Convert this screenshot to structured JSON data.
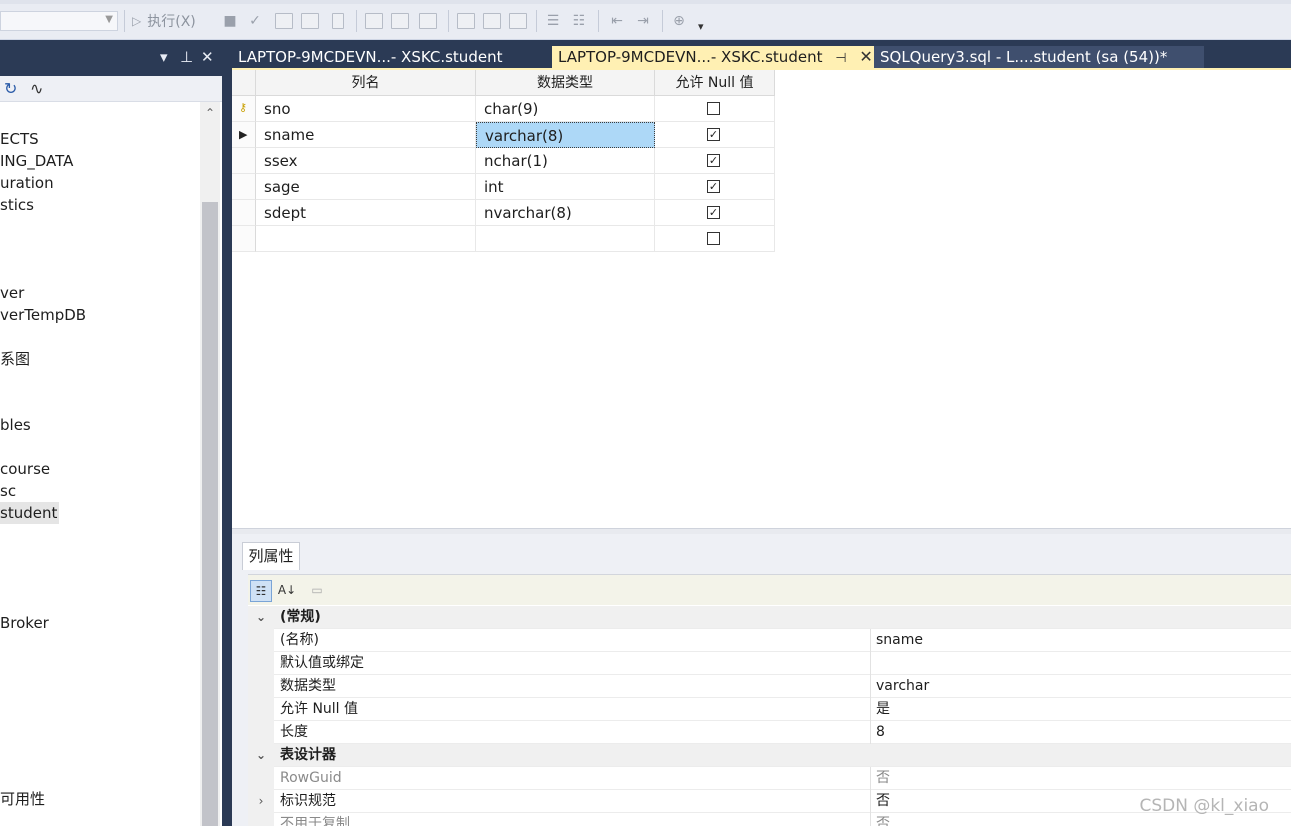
{
  "toolbar": {
    "execute_label": "执行(X)"
  },
  "explorer": {
    "tree_items": [
      "ECTS",
      "ING_DATA",
      "uration",
      "stics",
      "ver",
      "verTempDB",
      "系图",
      "",
      "bles",
      "",
      "course",
      "sc",
      "student",
      "Broker",
      "可用性"
    ]
  },
  "tabs": [
    {
      "label": "LAPTOP-9MCDEVN...- XSKC.student",
      "active": false
    },
    {
      "label": "LAPTOP-9MCDEVN...- XSKC.student",
      "active": true
    },
    {
      "label": "SQLQuery3.sql - L....student (sa (54))*",
      "active": false
    }
  ],
  "grid": {
    "headers": [
      "列名",
      "数据类型",
      "允许 Null 值"
    ],
    "rows": [
      {
        "name": "sno",
        "type": "char(9)",
        "nullable": false,
        "is_key": true,
        "current": false
      },
      {
        "name": "sname",
        "type": "varchar(8)",
        "nullable": true,
        "is_key": false,
        "current": true
      },
      {
        "name": "ssex",
        "type": "nchar(1)",
        "nullable": true,
        "is_key": false,
        "current": false
      },
      {
        "name": "sage",
        "type": "int",
        "nullable": true,
        "is_key": false,
        "current": false
      },
      {
        "name": "sdept",
        "type": "nvarchar(8)",
        "nullable": true,
        "is_key": false,
        "current": false
      },
      {
        "name": "",
        "type": "",
        "nullable": false,
        "is_key": false,
        "current": false
      }
    ]
  },
  "properties": {
    "tab_label": "列属性",
    "rows": [
      {
        "kind": "category",
        "name": "(常规)",
        "value": "",
        "gutter": "v"
      },
      {
        "kind": "prop",
        "name": "(名称)",
        "value": "sname"
      },
      {
        "kind": "prop",
        "name": "默认值或绑定",
        "value": ""
      },
      {
        "kind": "prop",
        "name": "数据类型",
        "value": "varchar"
      },
      {
        "kind": "prop",
        "name": "允许 Null 值",
        "value": "是"
      },
      {
        "kind": "prop",
        "name": "长度",
        "value": "8"
      },
      {
        "kind": "category",
        "name": "表设计器",
        "value": "",
        "gutter": "v"
      },
      {
        "kind": "disabled",
        "name": "RowGuid",
        "value": "否"
      },
      {
        "kind": "prop",
        "name": "标识规范",
        "value": "否",
        "gutter": ">"
      },
      {
        "kind": "disabled",
        "name": "不用于复制",
        "value": "否"
      }
    ]
  },
  "watermark": "CSDN @kl_xiao"
}
